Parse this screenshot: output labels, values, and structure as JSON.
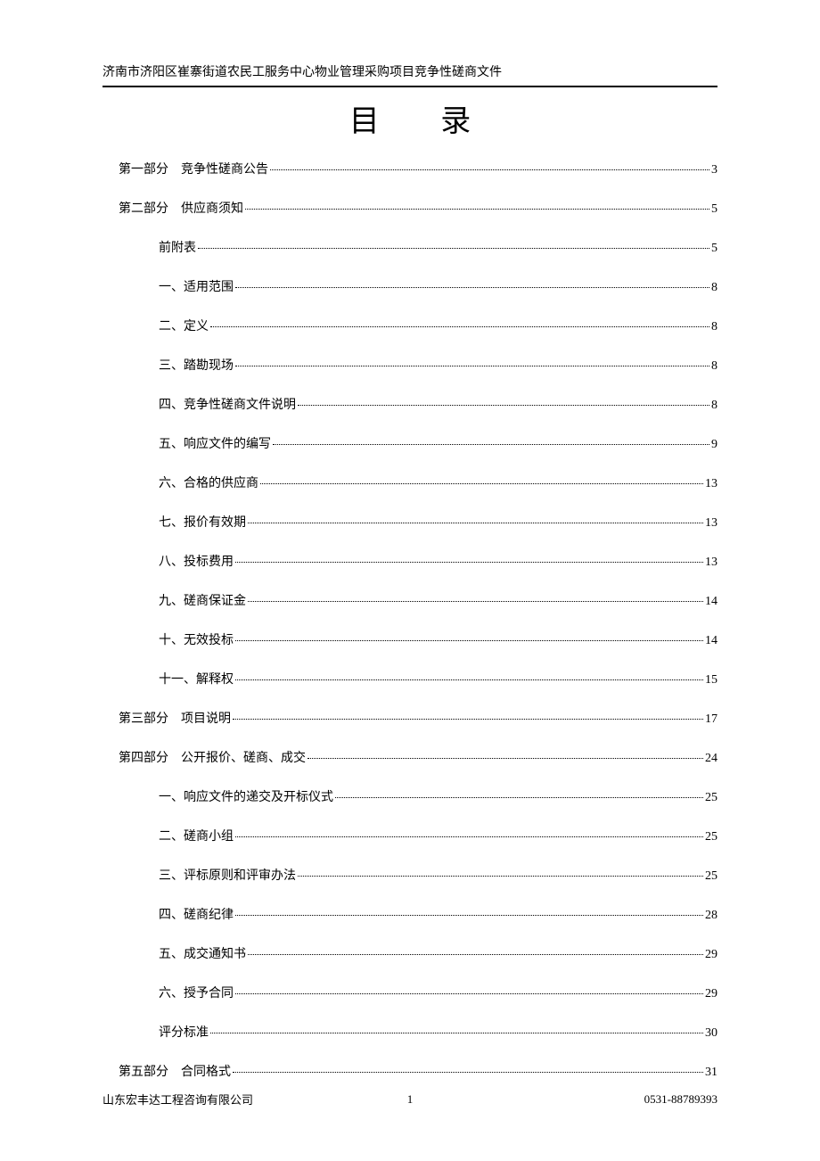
{
  "header": "济南市济阳区崔寨街道农民工服务中心物业管理采购项目竞争性磋商文件",
  "title": "目 录",
  "toc": [
    {
      "level": 1,
      "label": "第一部分　竞争性磋商公告",
      "page": "3"
    },
    {
      "level": 1,
      "label": "第二部分　供应商须知",
      "page": "5"
    },
    {
      "level": 2,
      "label": "前附表",
      "page": "5"
    },
    {
      "level": 2,
      "label": "一、适用范围",
      "page": "8"
    },
    {
      "level": 2,
      "label": "二、定义",
      "page": "8"
    },
    {
      "level": 2,
      "label": "三、踏勘现场",
      "page": "8"
    },
    {
      "level": 2,
      "label": "四、竞争性磋商文件说明",
      "page": "8"
    },
    {
      "level": 2,
      "label": "五、响应文件的编写",
      "page": "9"
    },
    {
      "level": 2,
      "label": "六、合格的供应商",
      "page": "13"
    },
    {
      "level": 2,
      "label": "七、报价有效期",
      "page": "13"
    },
    {
      "level": 2,
      "label": "八、投标费用",
      "page": "13"
    },
    {
      "level": 2,
      "label": "九、磋商保证金",
      "page": "14"
    },
    {
      "level": 2,
      "label": "十、无效投标",
      "page": "14"
    },
    {
      "level": 2,
      "label": "十一、解释权",
      "page": "15"
    },
    {
      "level": 1,
      "label": "第三部分　项目说明",
      "page": "17"
    },
    {
      "level": 1,
      "label": "第四部分　公开报价、磋商、成交",
      "page": "24"
    },
    {
      "level": 2,
      "label": "一、响应文件的递交及开标仪式",
      "page": "25"
    },
    {
      "level": 2,
      "label": "二、磋商小组",
      "page": "25"
    },
    {
      "level": 2,
      "label": "三、评标原则和评审办法",
      "page": "25"
    },
    {
      "level": 2,
      "label": "四、磋商纪律",
      "page": "28"
    },
    {
      "level": 2,
      "label": "五、成交通知书",
      "page": "29"
    },
    {
      "level": 2,
      "label": "六、授予合同",
      "page": "29"
    },
    {
      "level": 2,
      "label": "评分标准",
      "page": "30"
    },
    {
      "level": 1,
      "label": "第五部分　合同格式",
      "page": "31"
    }
  ],
  "footer": {
    "left": "山东宏丰达工程咨询有限公司",
    "center": "1",
    "right": "0531-88789393"
  }
}
